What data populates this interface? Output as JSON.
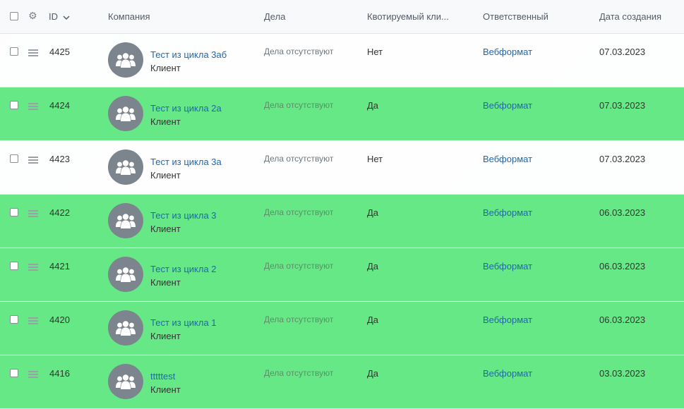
{
  "header": {
    "id_label": "ID",
    "company_label": "Компания",
    "deals_label": "Дела",
    "quoted_label": "Квотируемый кли...",
    "responsible_label": "Ответственный",
    "created_label": "Дата создания"
  },
  "rows": [
    {
      "id": "4425",
      "company": "Тест из цикла 3аб",
      "type": "Клиент",
      "deals": "Дела отсутствуют",
      "quoted": "Нет",
      "responsible": "Вебформат",
      "created": "07.03.2023",
      "highlight": "white"
    },
    {
      "id": "4424",
      "company": "Тест из цикла 2а",
      "type": "Клиент",
      "deals": "Дела отсутствуют",
      "quoted": "Да",
      "responsible": "Вебформат",
      "created": "07.03.2023",
      "highlight": "green"
    },
    {
      "id": "4423",
      "company": "Тест из цикла 3а",
      "type": "Клиент",
      "deals": "Дела отсутствуют",
      "quoted": "Нет",
      "responsible": "Вебформат",
      "created": "07.03.2023",
      "highlight": "white"
    },
    {
      "id": "4422",
      "company": "Тест из цикла 3",
      "type": "Клиент",
      "deals": "Дела отсутствуют",
      "quoted": "Да",
      "responsible": "Вебформат",
      "created": "06.03.2023",
      "highlight": "green"
    },
    {
      "id": "4421",
      "company": "Тест из цикла 2",
      "type": "Клиент",
      "deals": "Дела отсутствуют",
      "quoted": "Да",
      "responsible": "Вебформат",
      "created": "06.03.2023",
      "highlight": "green"
    },
    {
      "id": "4420",
      "company": "Тест из цикла 1",
      "type": "Клиент",
      "deals": "Дела отсутствуют",
      "quoted": "Да",
      "responsible": "Вебформат",
      "created": "06.03.2023",
      "highlight": "green"
    },
    {
      "id": "4416",
      "company": "tttttest",
      "type": "Клиент",
      "deals": "Дела отсутствуют",
      "quoted": "Да",
      "responsible": "Вебформат",
      "created": "03.03.2023",
      "highlight": "green"
    }
  ],
  "colors": {
    "highlight_green": "#66e887",
    "link": "#2067b0",
    "avatar": "#7c858d"
  },
  "icons": {
    "settings": "gear-icon",
    "sort": "chevron-down-icon",
    "drag": "drag-handle-icon",
    "avatar": "group-icon"
  }
}
